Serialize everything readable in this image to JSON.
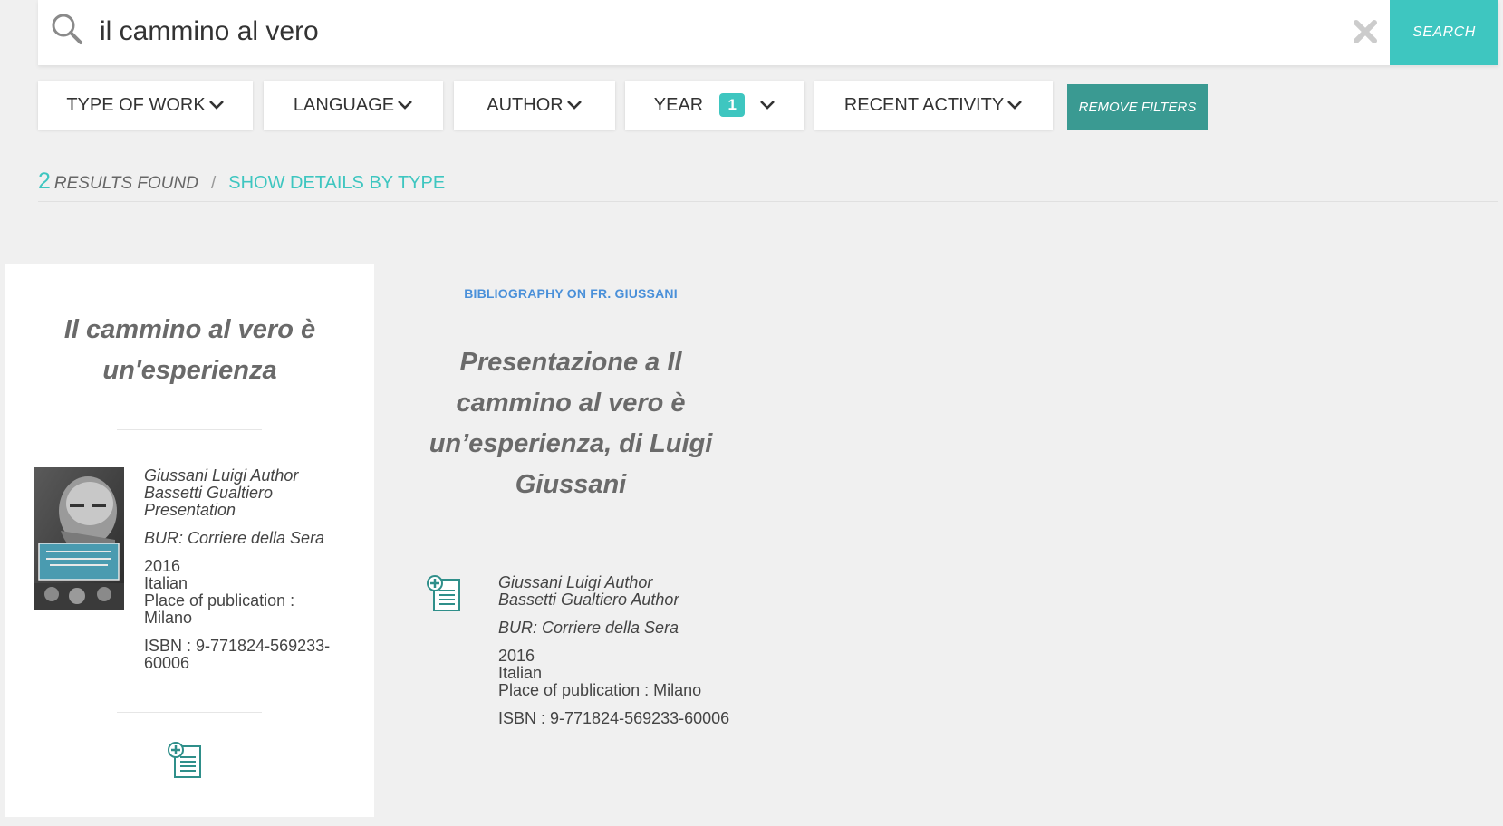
{
  "search": {
    "query": "il cammino al vero",
    "button_label": "SEARCH"
  },
  "filters": {
    "type_of_work": "TYPE OF WORK",
    "language": "LANGUAGE",
    "author": "AUTHOR",
    "year": "YEAR",
    "year_badge": "1",
    "recent_activity": "RECENT ACTIVITY",
    "remove_label": "REMOVE FILTERS"
  },
  "results": {
    "count": "2",
    "label": "RESULTS FOUND",
    "separator": "/",
    "details_link": "SHOW DETAILS BY TYPE"
  },
  "cards": [
    {
      "title": "Il cammino al vero è un'esperienza",
      "author_1": "Giussani Luigi Author",
      "author_2": "Bassetti Gualtiero Presentation",
      "publisher": "BUR: Corriere della Sera",
      "year": "2016",
      "language": "Italian",
      "place": "Place of publication : Milano",
      "isbn": "ISBN : 9-771824-569233-60006",
      "cover_icon": "book-cover-image",
      "action_icon": "add-document-icon"
    },
    {
      "category": "BIBLIOGRAPHY ON FR. GIUSSANI",
      "title": "Presentazione a Il cammino al vero è un’esperienza, di Luigi Giussani",
      "author_1": "Giussani Luigi Author",
      "author_2": "Bassetti Gualtiero Author",
      "publisher": "BUR: Corriere della Sera",
      "year": "2016",
      "language": "Italian",
      "place": "Place of publication : Milano",
      "isbn": "ISBN : 9-771824-569233-60006",
      "action_icon": "add-document-icon"
    }
  ],
  "colors": {
    "accent": "#3ec6c0",
    "remove_filters": "#3a9a92",
    "category_link": "#4a90d9",
    "icon": "#2f8f8a"
  }
}
